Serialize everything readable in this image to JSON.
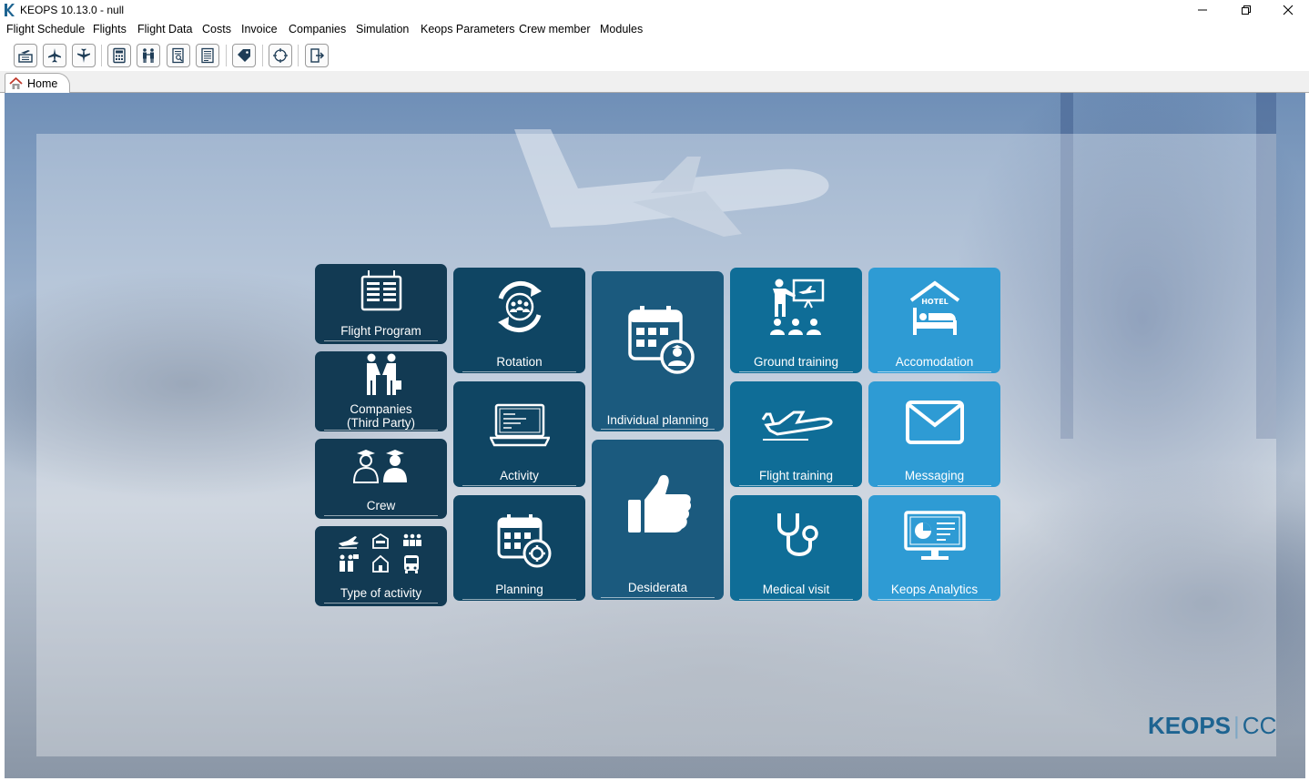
{
  "window": {
    "title": "KEOPS 10.13.0 - null"
  },
  "menu": {
    "items": [
      "Flight Schedule",
      "Flights",
      "Flight Data",
      "Costs",
      "Invoice",
      "Companies",
      "Simulation",
      "Keops Parameters",
      "Crew member",
      "Modules"
    ]
  },
  "toolbar": {
    "buttons": [
      "flight-schedule-icon",
      "airplane-icon",
      "flight-down-icon",
      "calculator-icon",
      "companies-icon",
      "report-search-icon",
      "report-list-icon",
      "tag-icon",
      "target-icon",
      "exit-icon"
    ]
  },
  "tabs": {
    "home": "Home"
  },
  "tiles": {
    "flight_program": "Flight Program",
    "companies_line1": "Companies",
    "companies_line2": "(Third Party)",
    "crew": "Crew",
    "type_of_activity": "Type of activity",
    "rotation": "Rotation",
    "activity": "Activity",
    "planning": "Planning",
    "individual_planning": "Individual planning",
    "desiderata": "Desiderata",
    "ground_training": "Ground training",
    "flight_training": "Flight training",
    "medical_visit": "Medical visit",
    "accomodation": "Accomodation",
    "messaging": "Messaging",
    "keops_analytics": "Keops Analytics"
  },
  "brand": {
    "name": "KEOPS",
    "suffix": "CC"
  },
  "colors": {
    "tile_dark": "#123a53",
    "tile_mid": "#1b5a7e",
    "tile_teal": "#0f6d97",
    "tile_sky": "#2e9bd4",
    "brand": "#1e6491"
  }
}
